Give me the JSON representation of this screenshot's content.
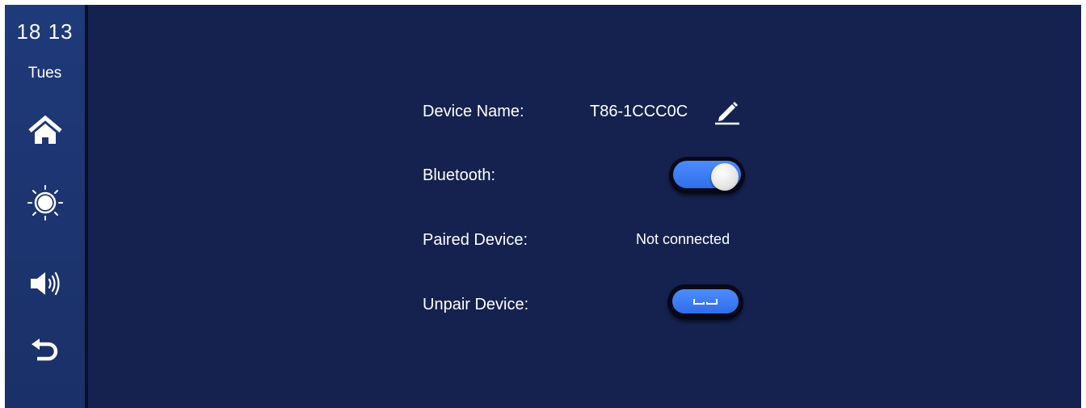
{
  "status": {
    "time": "18 13",
    "day": "Tues"
  },
  "sidebar": {
    "items": [
      {
        "icon": "home-icon"
      },
      {
        "icon": "brightness-icon"
      },
      {
        "icon": "volume-icon"
      },
      {
        "icon": "back-icon"
      }
    ]
  },
  "settings": {
    "device_name_label": "Device Name:",
    "device_name_value": "T86-1CCC0C",
    "bluetooth_label": "Bluetooth:",
    "bluetooth_enabled": true,
    "paired_device_label": "Paired Device:",
    "paired_device_value": "Not connected",
    "unpair_device_label": "Unpair Device:"
  },
  "colors": {
    "background": "#152250",
    "sidebar": "#1f3a7a",
    "accent": "#3a7bf5",
    "text": "#ffffff"
  }
}
